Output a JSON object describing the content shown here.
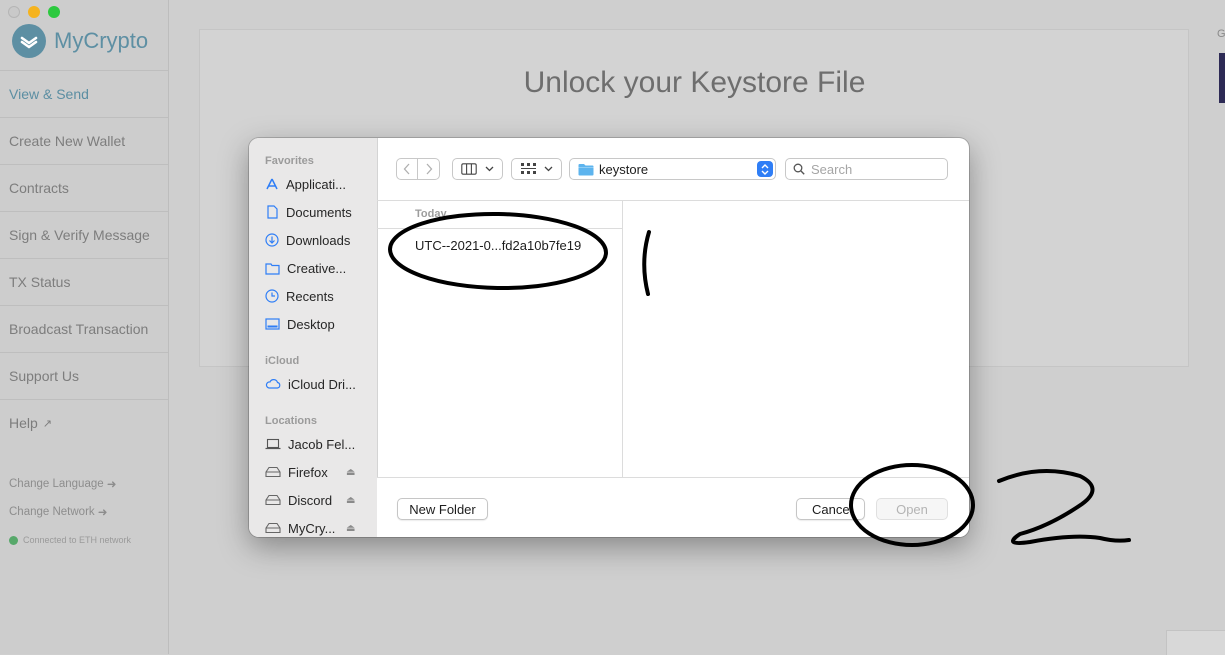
{
  "app": {
    "brand": "MyCrypto",
    "page_title": "Unlock your Keystore File",
    "nav_items": [
      {
        "label": "View & Send",
        "active": true
      },
      {
        "label": "Create New Wallet"
      },
      {
        "label": "Contracts"
      },
      {
        "label": "Sign & Verify Message"
      },
      {
        "label": "TX Status"
      },
      {
        "label": "Broadcast Transaction"
      },
      {
        "label": "Support Us"
      },
      {
        "label": "Help"
      }
    ],
    "change_language": "Change Language",
    "change_network": "Change Network",
    "connection_status": "Connected to ETH network",
    "edge_text": "G"
  },
  "dialog": {
    "favorites_heading": "Favorites",
    "favorites": [
      {
        "label": "Applicati...",
        "icon": "applications-icon"
      },
      {
        "label": "Documents",
        "icon": "documents-icon"
      },
      {
        "label": "Downloads",
        "icon": "downloads-icon"
      },
      {
        "label": "Creative...",
        "icon": "folder-icon"
      },
      {
        "label": "Recents",
        "icon": "recents-icon"
      },
      {
        "label": "Desktop",
        "icon": "desktop-icon"
      }
    ],
    "icloud_heading": "iCloud",
    "icloud": [
      {
        "label": "iCloud Dri...",
        "icon": "cloud-icon"
      }
    ],
    "locations_heading": "Locations",
    "locations": [
      {
        "label": "Jacob Fel...",
        "icon": "laptop-icon"
      },
      {
        "label": "Firefox",
        "icon": "disk-icon",
        "ejectable": true
      },
      {
        "label": "Discord",
        "icon": "disk-icon",
        "ejectable": true
      },
      {
        "label": "MyCry...",
        "icon": "disk-icon",
        "ejectable": true
      }
    ],
    "current_folder": "keystore",
    "search_placeholder": "Search",
    "column_heading": "Today",
    "files": [
      "UTC--2021-0...fd2a10b7fe19"
    ],
    "new_folder_label": "New Folder",
    "cancel_label": "Cancel",
    "open_label": "Open",
    "open_enabled": false
  },
  "annotations": {
    "mark_1": "(",
    "mark_2": "2"
  },
  "colors": {
    "brand": "#5d8fa3",
    "accent_blue": "#2f7ef6",
    "status_green": "#57a86a"
  }
}
